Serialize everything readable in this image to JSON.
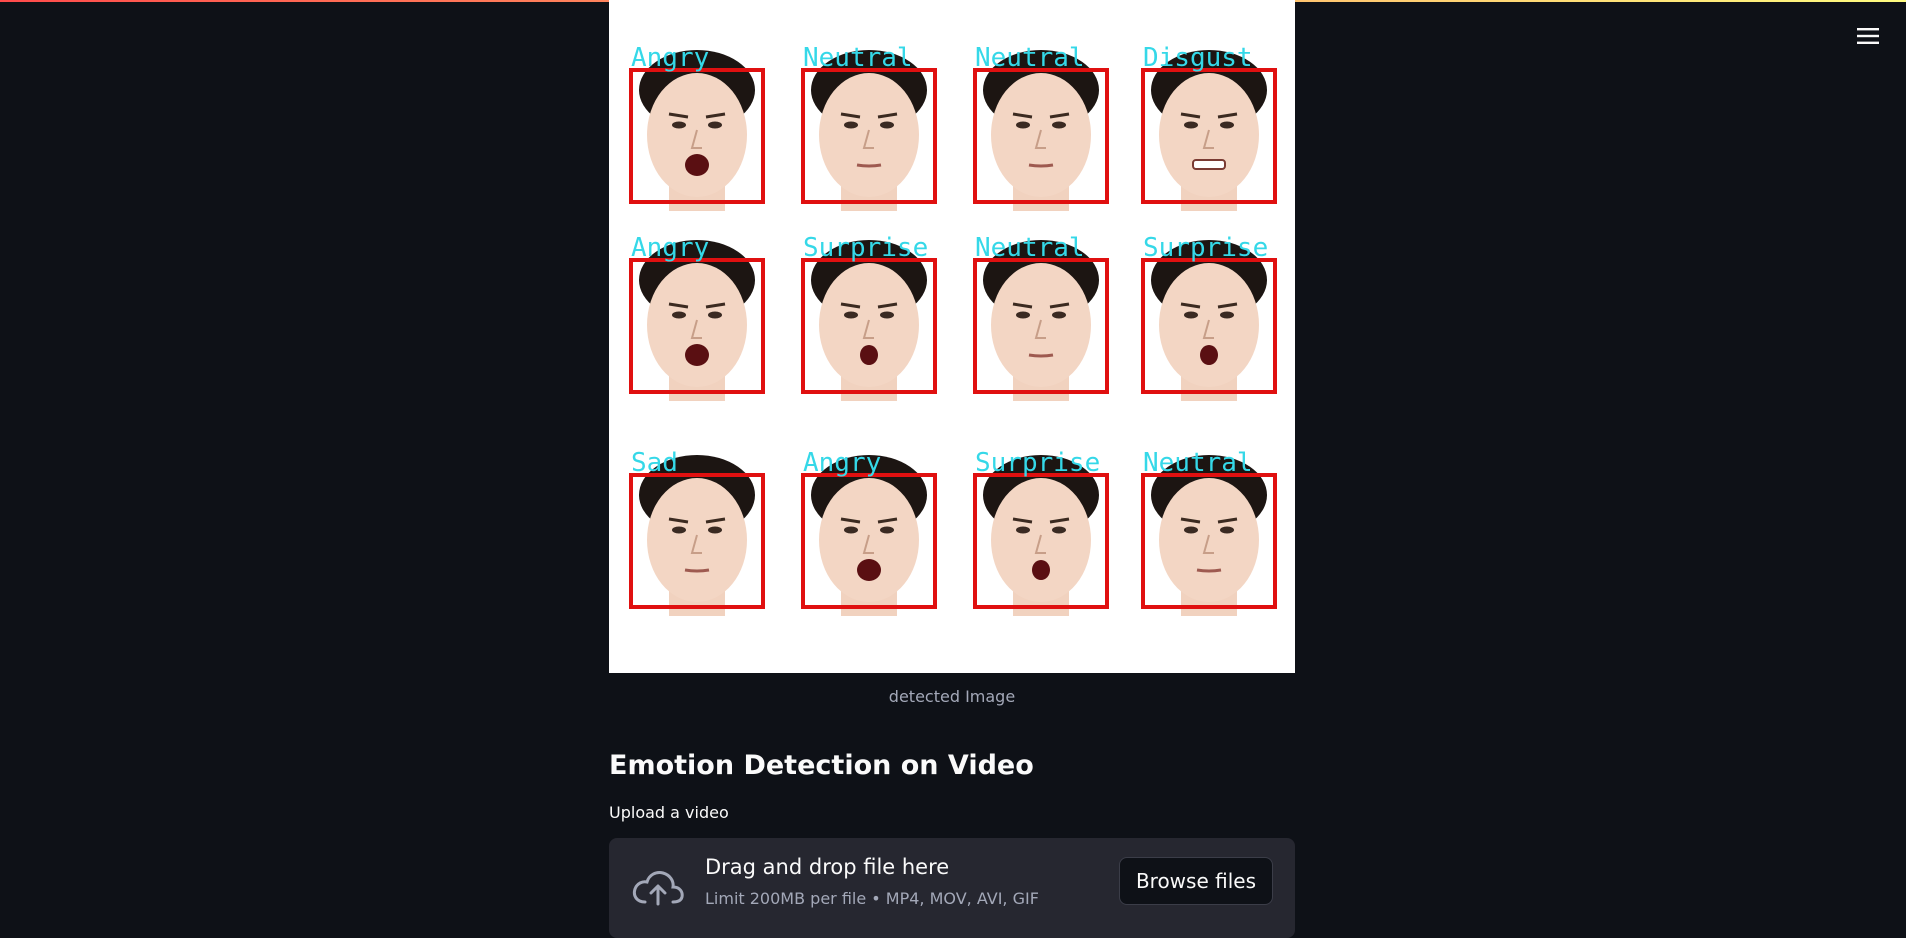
{
  "menu": {
    "icon": "hamburger-menu-icon"
  },
  "image": {
    "caption": "detected Image",
    "faces": [
      {
        "label": "Angry"
      },
      {
        "label": "Neutral"
      },
      {
        "label": "Neutral"
      },
      {
        "label": "Disgust"
      },
      {
        "label": "Angry"
      },
      {
        "label": "Surprise"
      },
      {
        "label": "Neutral"
      },
      {
        "label": "Surprise"
      },
      {
        "label": "Sad"
      },
      {
        "label": "Angry"
      },
      {
        "label": "Surprise"
      },
      {
        "label": "Neutral"
      }
    ]
  },
  "video_section": {
    "title": "Emotion Detection on Video",
    "upload_label": "Upload a video",
    "dropzone": {
      "icon": "cloud-upload-icon",
      "instructions": "Drag and drop file here",
      "limit": "Limit 200MB per file • MP4, MOV, AVI, GIF",
      "browse_label": "Browse files"
    }
  },
  "colors": {
    "background": "#0e1117",
    "dropzone": "#262730",
    "box": "#e01010",
    "label": "#35d8e8"
  }
}
